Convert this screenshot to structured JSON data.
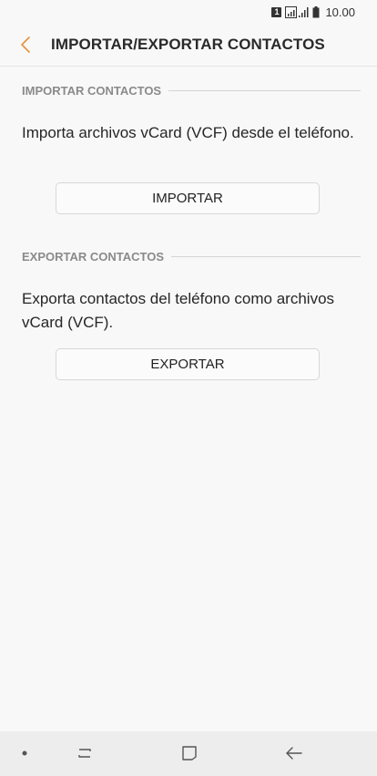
{
  "status_bar": {
    "sim_label": "1",
    "time": "10.00"
  },
  "app_bar": {
    "title": "IMPORTAR/EXPORTAR CONTACTOS",
    "accent_color": "#e8913a"
  },
  "import_section": {
    "header": "IMPORTAR CONTACTOS",
    "description": "Importa archivos vCard (VCF) desde el teléfono.",
    "button_label": "IMPORTAR"
  },
  "export_section": {
    "header": "EXPORTAR CONTACTOS",
    "description": "Exporta contactos del teléfono como archivos vCard (VCF).",
    "button_label": "EXPORTAR"
  },
  "nav_bar": {
    "items": [
      "dot-icon",
      "recents-icon",
      "home-icon",
      "back-arrow-icon"
    ]
  }
}
